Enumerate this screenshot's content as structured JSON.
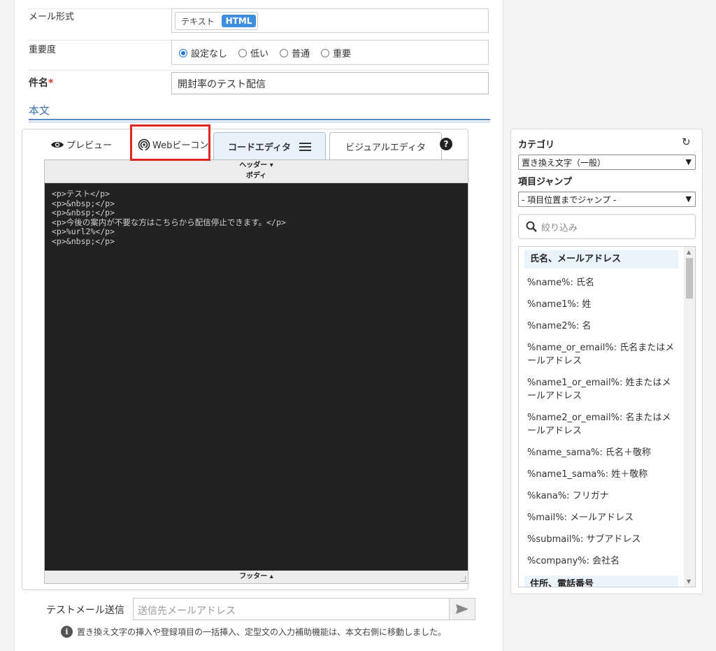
{
  "form": {
    "mail_format_label": "メール形式",
    "mail_format_options": [
      "テキスト",
      "HTML"
    ],
    "priority_label": "重要度",
    "priority_options": [
      "設定なし",
      "低い",
      "普通",
      "重要"
    ],
    "priority_selected": "設定なし",
    "subject_label": "件名",
    "required_mark": "*",
    "subject_value": "開封率のテスト配信",
    "body_section_label": "本文"
  },
  "editor": {
    "tabs": {
      "preview": "プレビュー",
      "web_beacon": "Webビーコン",
      "code_editor": "コードエディタ",
      "visual_editor": "ビジュアルエディタ"
    },
    "active_tab": "コードエディタ",
    "header_strip": "ヘッダー ▾",
    "body_strip": "ボディ",
    "footer_strip": "フッター ▴",
    "code_lines": [
      "<p>テスト</p>",
      "<p>&nbsp;</p>",
      "<p>&nbsp;</p>",
      "<p>今後の案内が不要な方はこちらから配信停止できます。</p>",
      "<p>%url2%</p>",
      "<p>&nbsp;</p>"
    ],
    "highlight_color": "#e0281e"
  },
  "test_mail": {
    "label": "テストメール送信",
    "placeholder": "送信先メールアドレス"
  },
  "notice": "置き換え文字の挿入や登録項目の一括挿入、定型文の入力補助機能は、本文右側に移動しました。",
  "sidebar": {
    "category_label": "カテゴリ",
    "category_value": "置き換え文字（一般）",
    "jump_label": "項目ジャンプ",
    "jump_value": "- 項目位置までジャンプ -",
    "filter_placeholder": "絞り込み",
    "groups": [
      {
        "title": "氏名、メールアドレス",
        "items": [
          "%name%: 氏名",
          "%name1%: 姓",
          "%name2%: 名",
          "%name_or_email%: 氏名またはメールアドレス",
          "%name1_or_email%: 姓またはメールアドレス",
          "%name2_or_email%: 名またはメールアドレス",
          "%name_sama%: 氏名＋敬称",
          "%name1_sama%: 姓＋敬称",
          "%kana%: フリガナ",
          "%mail%: メールアドレス",
          "%submail%: サブアドレス",
          "%company%: 会社名"
        ]
      },
      {
        "title": "住所、電話番号",
        "items": []
      }
    ]
  }
}
